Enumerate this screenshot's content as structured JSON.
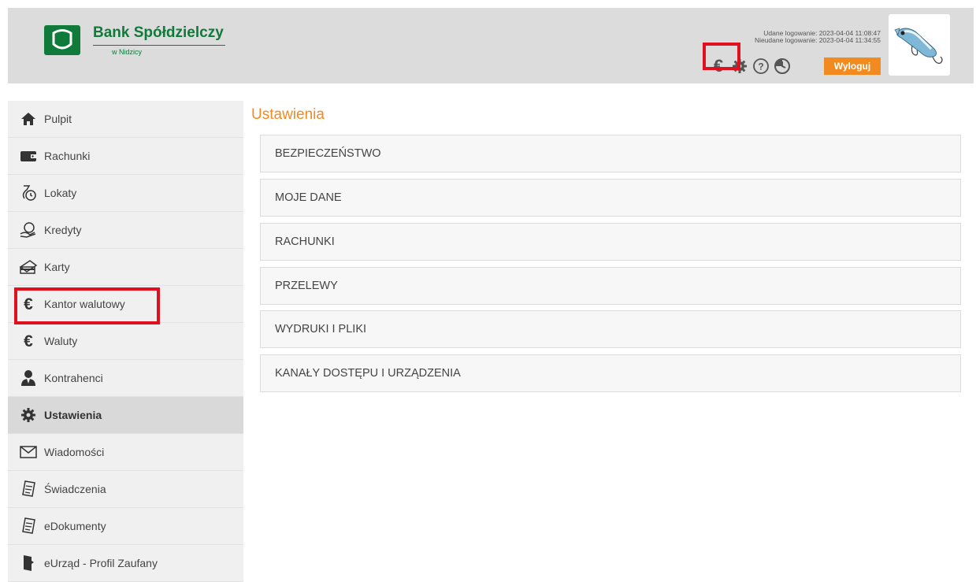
{
  "header": {
    "bank_name": "Bank Spółdzielczy",
    "bank_sub": "w Nidzicy",
    "login_success": "Udane logowanie: 2023-04-04 11:08:47",
    "login_failed": "Nieudane logowanie: 2023-04-04 11:34:55",
    "logout_label": "Wyloguj",
    "icons": [
      "euro-icon",
      "gear-icon",
      "help-icon",
      "clock-icon"
    ],
    "accent_color": "#f18a1f",
    "brand_color": "#0f7a39",
    "highlight_color": "#e0101e"
  },
  "sidebar": {
    "items": [
      {
        "label": "Pulpit",
        "icon": "home-icon"
      },
      {
        "label": "Rachunki",
        "icon": "wallet-icon"
      },
      {
        "label": "Lokaty",
        "icon": "deposit-icon"
      },
      {
        "label": "Kredyty",
        "icon": "credit-icon"
      },
      {
        "label": "Karty",
        "icon": "card-icon"
      },
      {
        "label": "Kantor walutowy",
        "icon": "euro-icon"
      },
      {
        "label": "Waluty",
        "icon": "euro-icon"
      },
      {
        "label": "Kontrahenci",
        "icon": "person-icon"
      },
      {
        "label": "Ustawienia",
        "icon": "gear-icon",
        "active": true
      },
      {
        "label": "Wiadomości",
        "icon": "mail-icon"
      },
      {
        "label": "Świadczenia",
        "icon": "document-icon"
      },
      {
        "label": "eDokumenty",
        "icon": "document-icon"
      },
      {
        "label": "eUrząd - Profil Zaufany",
        "icon": "door-icon"
      }
    ]
  },
  "main": {
    "title": "Ustawienia",
    "sections": [
      "BEZPIECZEŃSTWO",
      "MOJE DANE",
      "RACHUNKI",
      "PRZELEWY",
      "WYDRUKI I PLIKI",
      "KANAŁY DOSTĘPU I URZĄDZENIA"
    ]
  }
}
